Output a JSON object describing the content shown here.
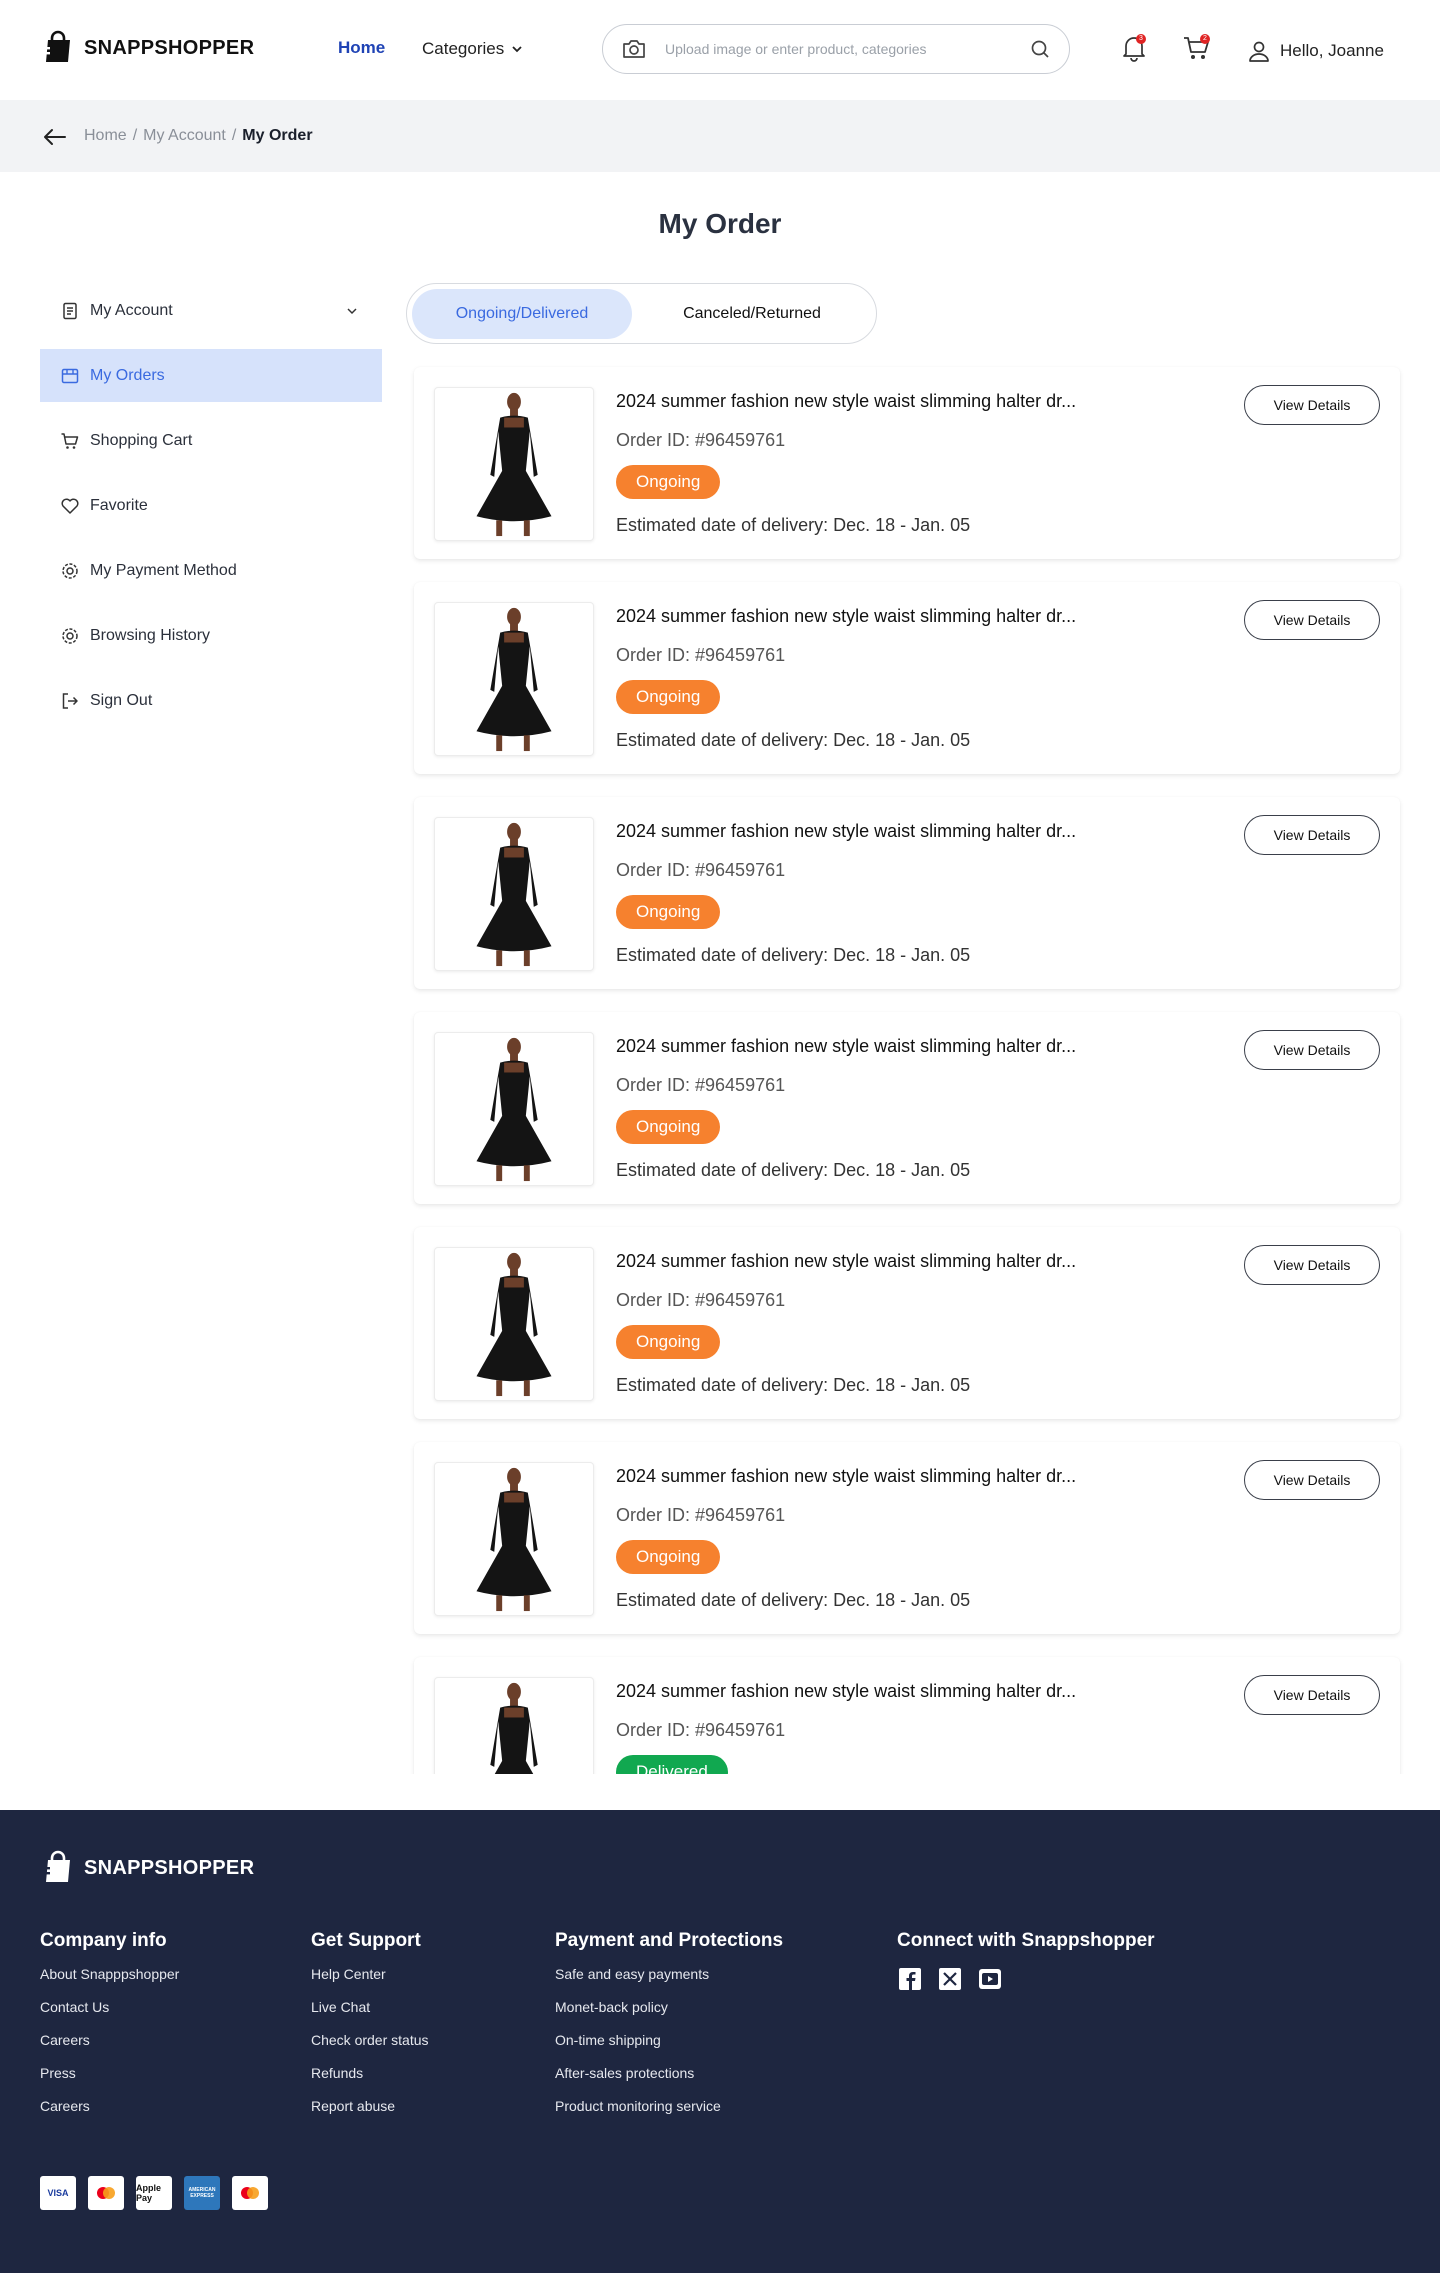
{
  "brand": {
    "name": "SNAPPSHOPPER"
  },
  "nav": {
    "home": "Home",
    "categories": "Categories"
  },
  "search": {
    "placeholder": "Upload image or enter product, categories"
  },
  "header": {
    "notif_count": "3",
    "cart_count": "2",
    "greeting": "Hello, Joanne"
  },
  "breadcrumb": {
    "home": "Home",
    "account": "My Account",
    "current": "My Order",
    "sep": "/"
  },
  "page": {
    "title": "My Order"
  },
  "sidebar": {
    "items": [
      {
        "label": "My Account",
        "icon": "document-icon"
      },
      {
        "label": "My Orders",
        "icon": "orders-icon"
      },
      {
        "label": "Shopping Cart",
        "icon": "cart-icon"
      },
      {
        "label": "Favorite",
        "icon": "heart-icon"
      },
      {
        "label": "My Payment Method",
        "icon": "gear-icon"
      },
      {
        "label": "Browsing History",
        "icon": "gear-icon"
      },
      {
        "label": "Sign Out",
        "icon": "signout-icon"
      }
    ]
  },
  "tabs": {
    "ongoing": "Ongoing/Delivered",
    "canceled": "Canceled/Returned"
  },
  "orders": [
    {
      "title": "2024 summer fashion new style waist slimming halter dr...",
      "id": "Order ID: #96459761",
      "status": "Ongoing",
      "eta": "Estimated date of delivery: Dec. 18 - Jan. 05",
      "button": "View Details"
    },
    {
      "title": "2024 summer fashion new style waist slimming halter dr...",
      "id": "Order ID: #96459761",
      "status": "Ongoing",
      "eta": "Estimated date of delivery: Dec. 18 - Jan. 05",
      "button": "View Details"
    },
    {
      "title": "2024 summer fashion new style waist slimming halter dr...",
      "id": "Order ID: #96459761",
      "status": "Ongoing",
      "eta": "Estimated date of delivery: Dec. 18 - Jan. 05",
      "button": "View Details"
    },
    {
      "title": "2024 summer fashion new style waist slimming halter dr...",
      "id": "Order ID: #96459761",
      "status": "Ongoing",
      "eta": "Estimated date of delivery: Dec. 18 - Jan. 05",
      "button": "View Details"
    },
    {
      "title": "2024 summer fashion new style waist slimming halter dr...",
      "id": "Order ID: #96459761",
      "status": "Ongoing",
      "eta": "Estimated date of delivery: Dec. 18 - Jan. 05",
      "button": "View Details"
    },
    {
      "title": "2024 summer fashion new style waist slimming halter dr...",
      "id": "Order ID: #96459761",
      "status": "Ongoing",
      "eta": "Estimated date of delivery: Dec. 18 - Jan. 05",
      "button": "View Details"
    },
    {
      "title": "2024 summer fashion new style waist slimming halter dr...",
      "id": "Order ID: #96459761",
      "status": "Delivered",
      "eta": "",
      "button": "View Details"
    }
  ],
  "colors": {
    "ongoing": "#f6812e",
    "delivered": "#11a850",
    "accent": "#3a6ae0",
    "footer_bg": "#1e2640"
  },
  "footer": {
    "company": {
      "heading": "Company info",
      "links": [
        "About Snapppshopper",
        "Contact Us",
        "Careers",
        "Press",
        "Careers"
      ]
    },
    "support": {
      "heading": "Get Support",
      "links": [
        "Help Center",
        "Live Chat",
        "Check order status",
        "Refunds",
        "Report abuse"
      ]
    },
    "payment": {
      "heading": "Payment and Protections",
      "links": [
        "Safe and easy payments",
        "Monet-back policy",
        "On-time shipping",
        "After-sales protections",
        "Product monitoring service"
      ]
    },
    "connect": {
      "heading": "Connect with Snappshopper",
      "icons": [
        "facebook-icon",
        "x-icon",
        "youtube-icon"
      ]
    },
    "payment_cards": [
      "VISA",
      "mastercard",
      "Apple Pay",
      "AMERICAN EXPRESS",
      "mastercard"
    ]
  }
}
